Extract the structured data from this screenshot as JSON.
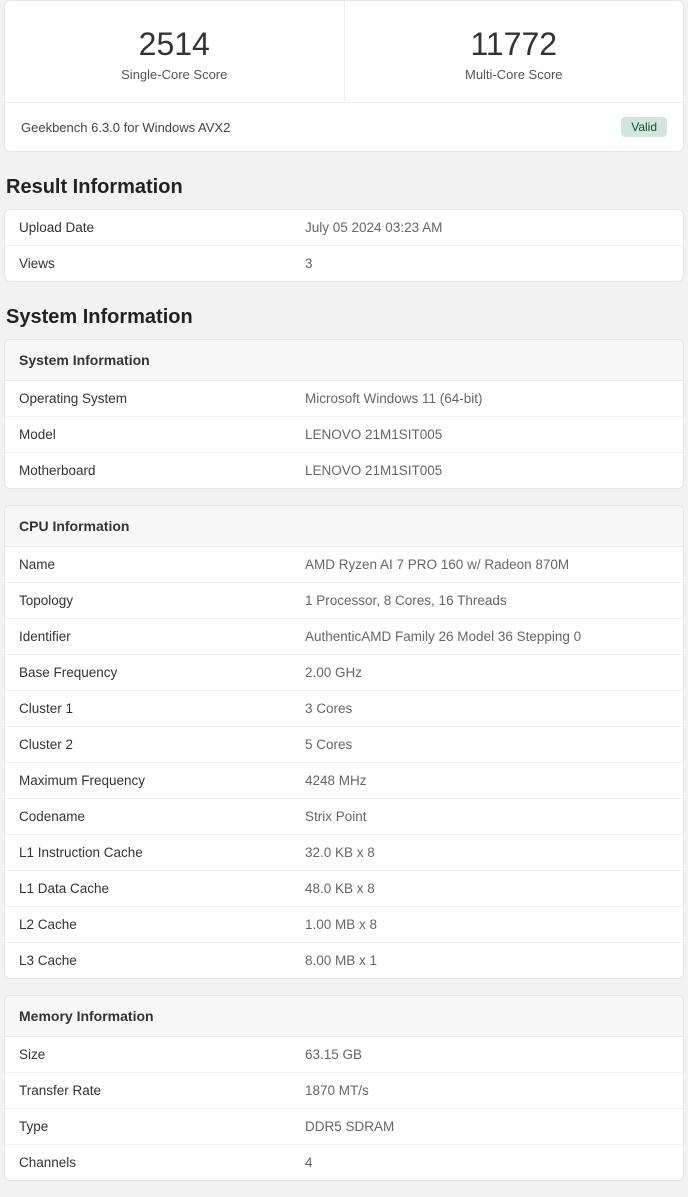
{
  "scores": {
    "single_value": "2514",
    "single_label": "Single-Core Score",
    "multi_value": "11772",
    "multi_label": "Multi-Core Score"
  },
  "footer": {
    "version": "Geekbench 6.3.0 for Windows AVX2",
    "badge": "Valid"
  },
  "result_info": {
    "title": "Result Information",
    "rows": [
      {
        "key": "Upload Date",
        "val": "July 05 2024 03:23 AM"
      },
      {
        "key": "Views",
        "val": "3"
      }
    ]
  },
  "system_info": {
    "title": "System Information",
    "system": {
      "header": "System Information",
      "rows": [
        {
          "key": "Operating System",
          "val": "Microsoft Windows 11 (64-bit)"
        },
        {
          "key": "Model",
          "val": "LENOVO 21M1SIT005"
        },
        {
          "key": "Motherboard",
          "val": "LENOVO 21M1SIT005"
        }
      ]
    },
    "cpu": {
      "header": "CPU Information",
      "rows": [
        {
          "key": "Name",
          "val": "AMD Ryzen AI 7 PRO 160 w/ Radeon 870M"
        },
        {
          "key": "Topology",
          "val": "1 Processor, 8 Cores, 16 Threads"
        },
        {
          "key": "Identifier",
          "val": "AuthenticAMD Family 26 Model 36 Stepping 0"
        },
        {
          "key": "Base Frequency",
          "val": "2.00 GHz"
        },
        {
          "key": "Cluster 1",
          "val": "3 Cores"
        },
        {
          "key": "Cluster 2",
          "val": "5 Cores"
        },
        {
          "key": "Maximum Frequency",
          "val": "4248 MHz"
        },
        {
          "key": "Codename",
          "val": "Strix Point"
        },
        {
          "key": "L1 Instruction Cache",
          "val": "32.0 KB x 8"
        },
        {
          "key": "L1 Data Cache",
          "val": "48.0 KB x 8"
        },
        {
          "key": "L2 Cache",
          "val": "1.00 MB x 8"
        },
        {
          "key": "L3 Cache",
          "val": "8.00 MB x 1"
        }
      ]
    },
    "memory": {
      "header": "Memory Information",
      "rows": [
        {
          "key": "Size",
          "val": "63.15 GB"
        },
        {
          "key": "Transfer Rate",
          "val": "1870 MT/s"
        },
        {
          "key": "Type",
          "val": "DDR5 SDRAM"
        },
        {
          "key": "Channels",
          "val": "4"
        }
      ]
    }
  }
}
